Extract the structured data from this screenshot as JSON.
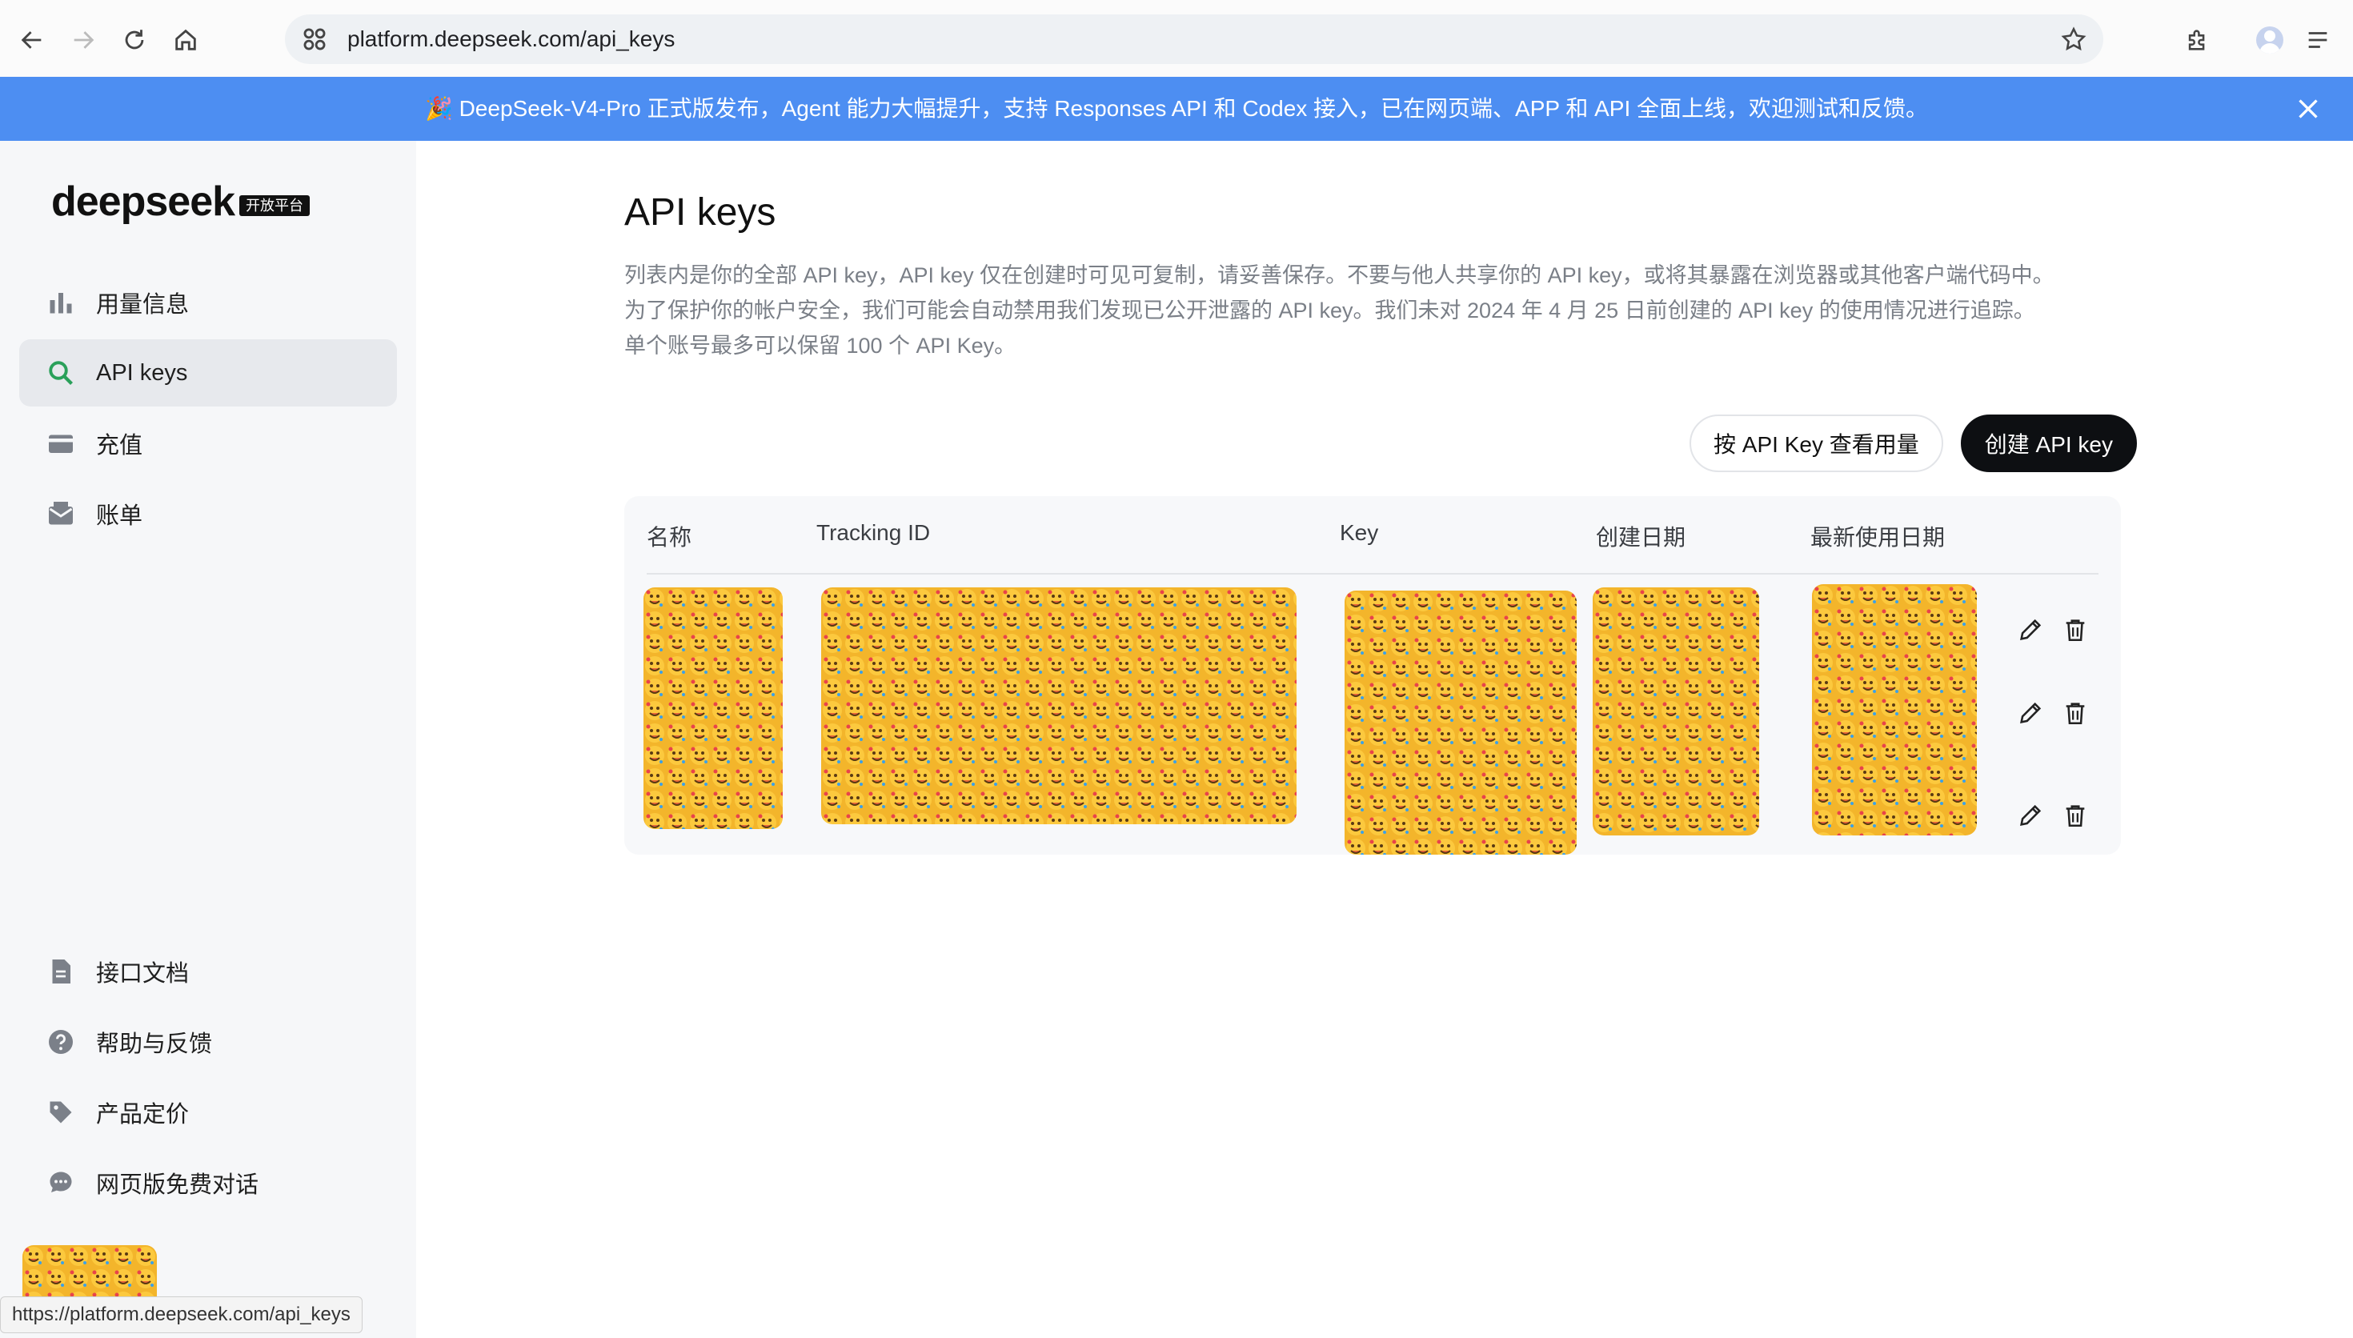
{
  "browser": {
    "url": "platform.deepseek.com/api_keys",
    "status_url": "https://platform.deepseek.com/api_keys"
  },
  "banner": {
    "text": "🎉 DeepSeek-V4-Pro 正式版发布，Agent 能力大幅提升，支持 Responses API 和 Codex 接入，已在网页端、APP 和 API 全面上线，欢迎测试和反馈。",
    "color": "#4d8ef2"
  },
  "sidebar": {
    "logo": "deepseek",
    "logo_tag": "开放平台",
    "nav_items": [
      {
        "label": "用量信息",
        "icon": "bar-chart-icon"
      },
      {
        "label": "API keys",
        "icon": "search-icon",
        "active": true
      },
      {
        "label": "充值",
        "icon": "wallet-icon"
      },
      {
        "label": "账单",
        "icon": "mail-icon"
      }
    ],
    "bottom_items": [
      {
        "label": "接口文档",
        "icon": "document-icon"
      },
      {
        "label": "帮助与反馈",
        "icon": "help-icon"
      },
      {
        "label": "产品定价",
        "icon": "tag-icon"
      },
      {
        "label": "网页版免费对话",
        "icon": "chat-icon"
      }
    ]
  },
  "main": {
    "title": "API keys",
    "description": [
      "列表内是你的全部 API key，API key 仅在创建时可见可复制，请妥善保存。不要与他人共享你的 API key，或将其暴露在浏览器或其他客户端代码中。",
      "为了保护你的帐户安全，我们可能会自动禁用我们发现已公开泄露的 API key。我们未对 2024 年 4 月 25 日前创建的 API key 的使用情况进行追踪。",
      "单个账号最多可以保留 100 个 API Key。"
    ],
    "buttons": {
      "view_usage": "按 API Key 查看用量",
      "create": "创建 API key"
    },
    "table": {
      "columns": [
        "名称",
        "Tracking ID",
        "Key",
        "创建日期",
        "最新使用日期"
      ],
      "row_count": 3,
      "redacted": true
    }
  },
  "colors": {
    "accent": "#4d8ef2",
    "primary_button": "#0d0f12",
    "sidebar_bg": "#f6f7f9",
    "active_icon": "#2aa05a"
  }
}
